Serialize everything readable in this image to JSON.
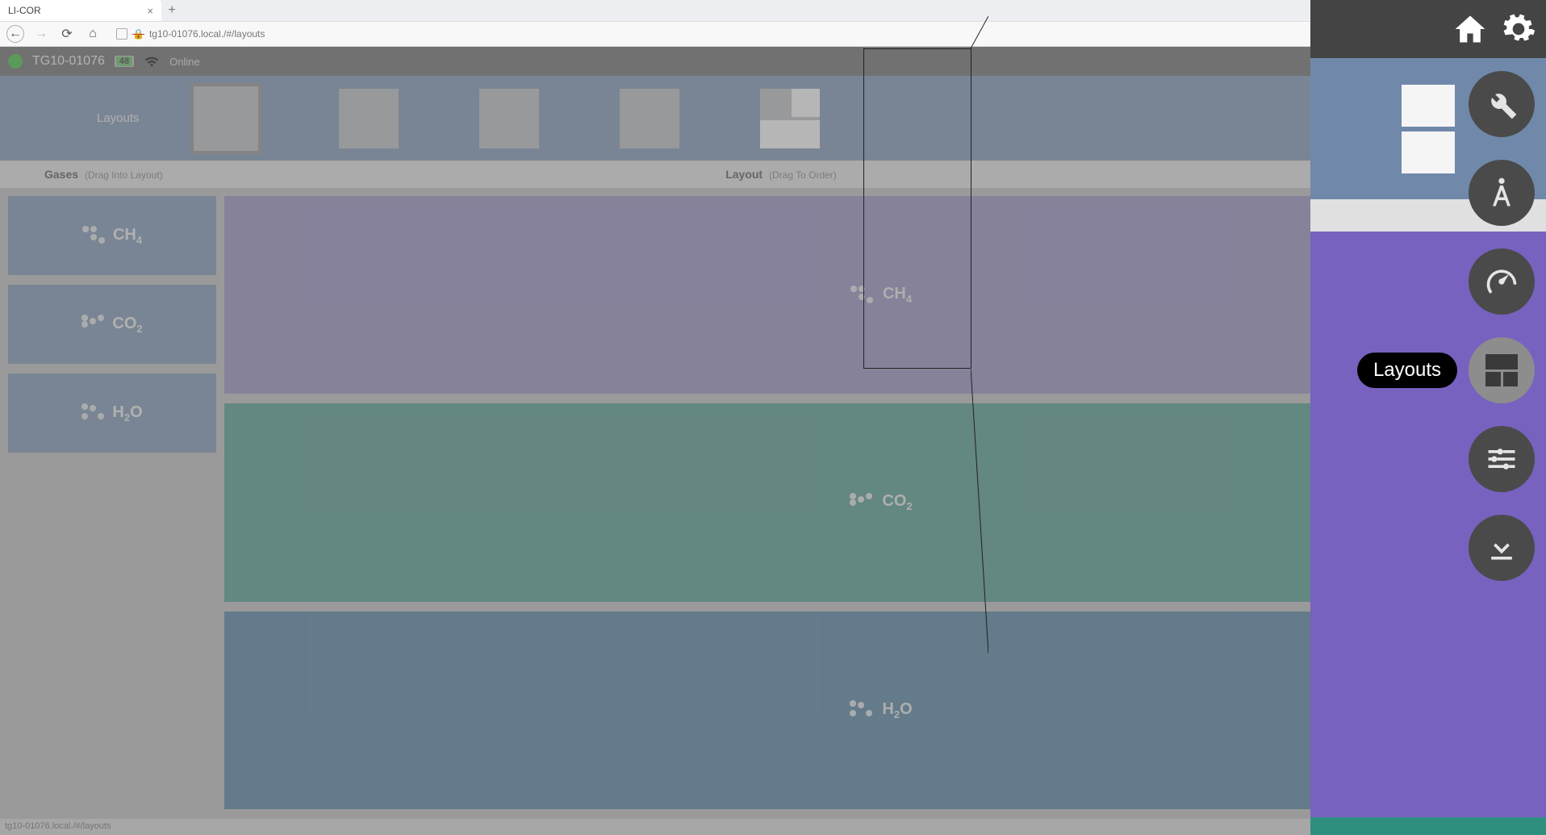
{
  "browser": {
    "tab_title": "LI-COR",
    "url": "tg10-01076.local./#/layouts",
    "status_url": "tg10-01076.local./#/layouts"
  },
  "app_header": {
    "device_name": "TG10-01076",
    "battery_level": "48",
    "connection": "Online"
  },
  "layout_bar": {
    "label": "Layouts"
  },
  "sections": {
    "gases_label": "Gases",
    "gases_hint": "(Drag Into Layout)",
    "layout_label": "Layout",
    "layout_hint": "(Drag To Order)"
  },
  "gases": {
    "items": [
      "CH",
      "CO",
      "H",
      "O"
    ],
    "ch4": "CH",
    "ch4_sub": "4",
    "co2": "CO",
    "co2_sub": "2",
    "h2o_h": "H",
    "h2o_sub": "2",
    "h2o_o": "O"
  },
  "tooltip": {
    "layouts": "Layouts"
  },
  "zoom": {
    "tooltip_layouts": "Layouts"
  }
}
